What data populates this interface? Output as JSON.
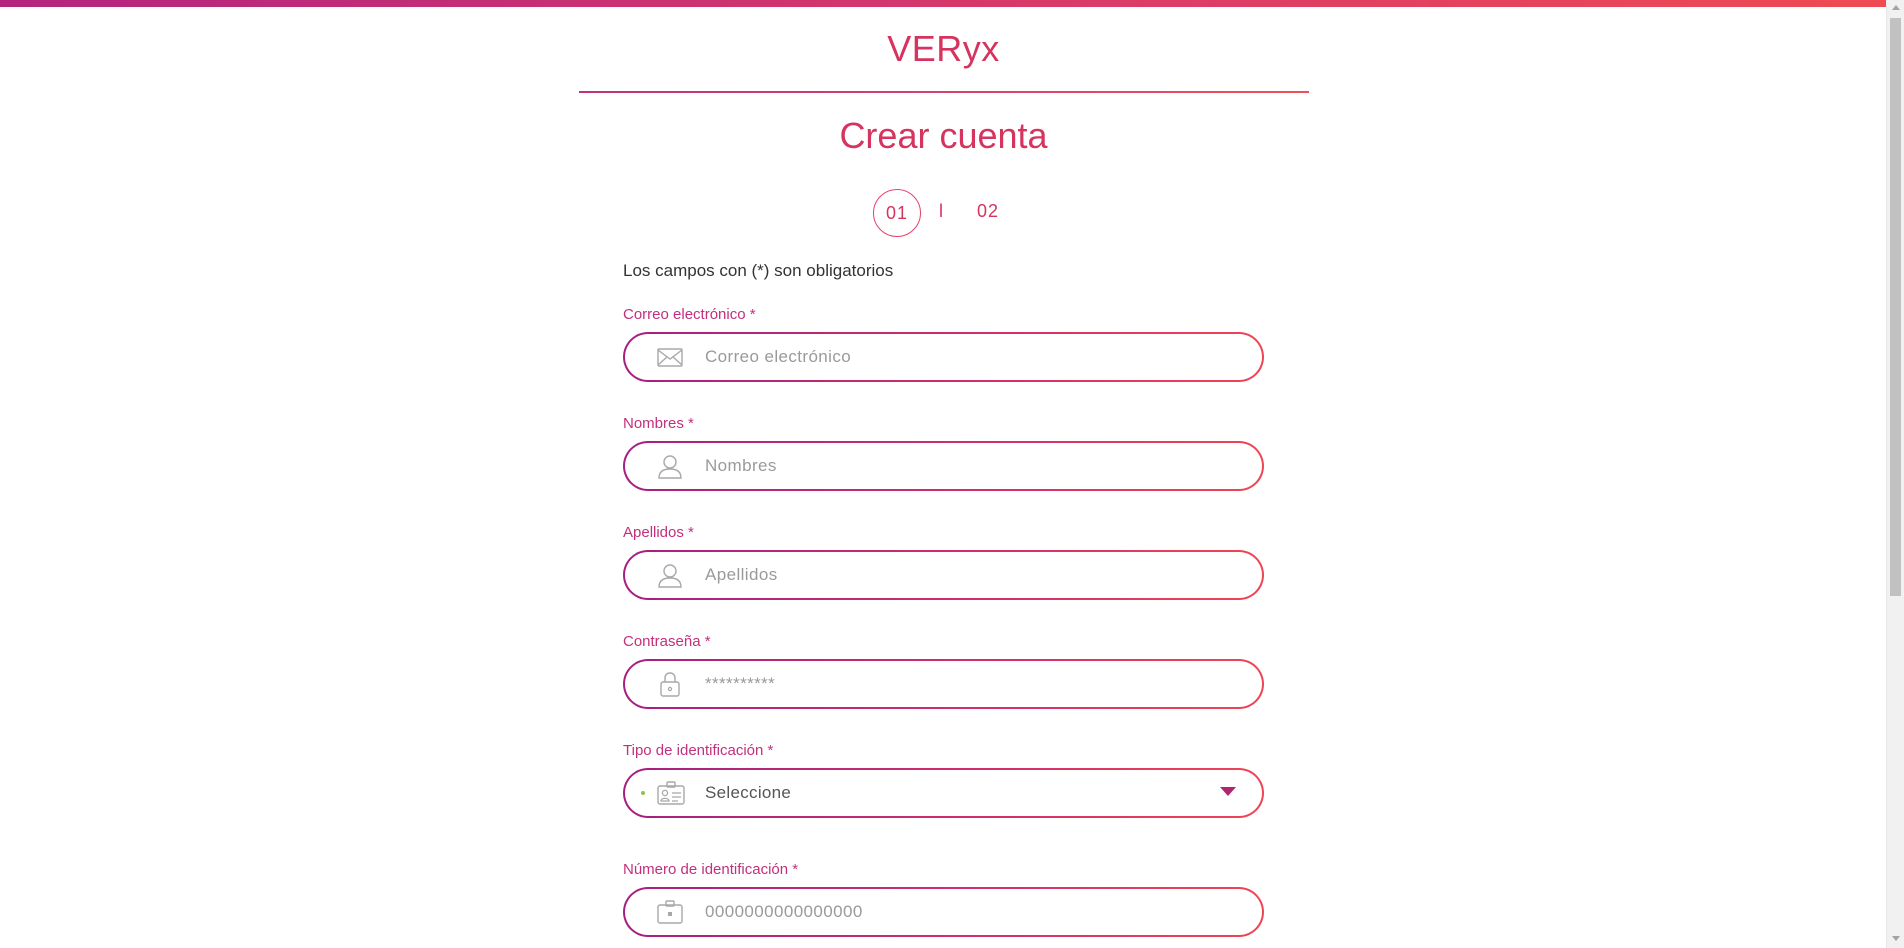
{
  "colors": {
    "accent": "#d6335f",
    "label": "#c2307d",
    "gradient_start": "#a52082",
    "gradient_end": "#ee4654",
    "indicator_dot": "#8cc63f"
  },
  "header": {
    "logo": "VERyx",
    "title": "Crear cuenta"
  },
  "stepper": {
    "current": "01",
    "separator": "l",
    "next": "02"
  },
  "form": {
    "required_note": "Los campos con (*) son obligatorios",
    "fields": [
      {
        "label": "Correo electrónico *",
        "placeholder": "Correo electrónico",
        "icon": "envelope-icon"
      },
      {
        "label": "Nombres *",
        "placeholder": "Nombres",
        "icon": "user-icon"
      },
      {
        "label": "Apellidos *",
        "placeholder": "Apellidos",
        "icon": "user-icon"
      },
      {
        "label": "Contraseña *",
        "placeholder": "**********",
        "icon": "lock-icon"
      },
      {
        "label": "Tipo de identificación *",
        "selected": "Seleccione",
        "icon": "id-card-icon",
        "type": "select"
      },
      {
        "label": "Número de identificación *",
        "placeholder": "0000000000000000",
        "icon": "id-badge-icon"
      }
    ]
  }
}
